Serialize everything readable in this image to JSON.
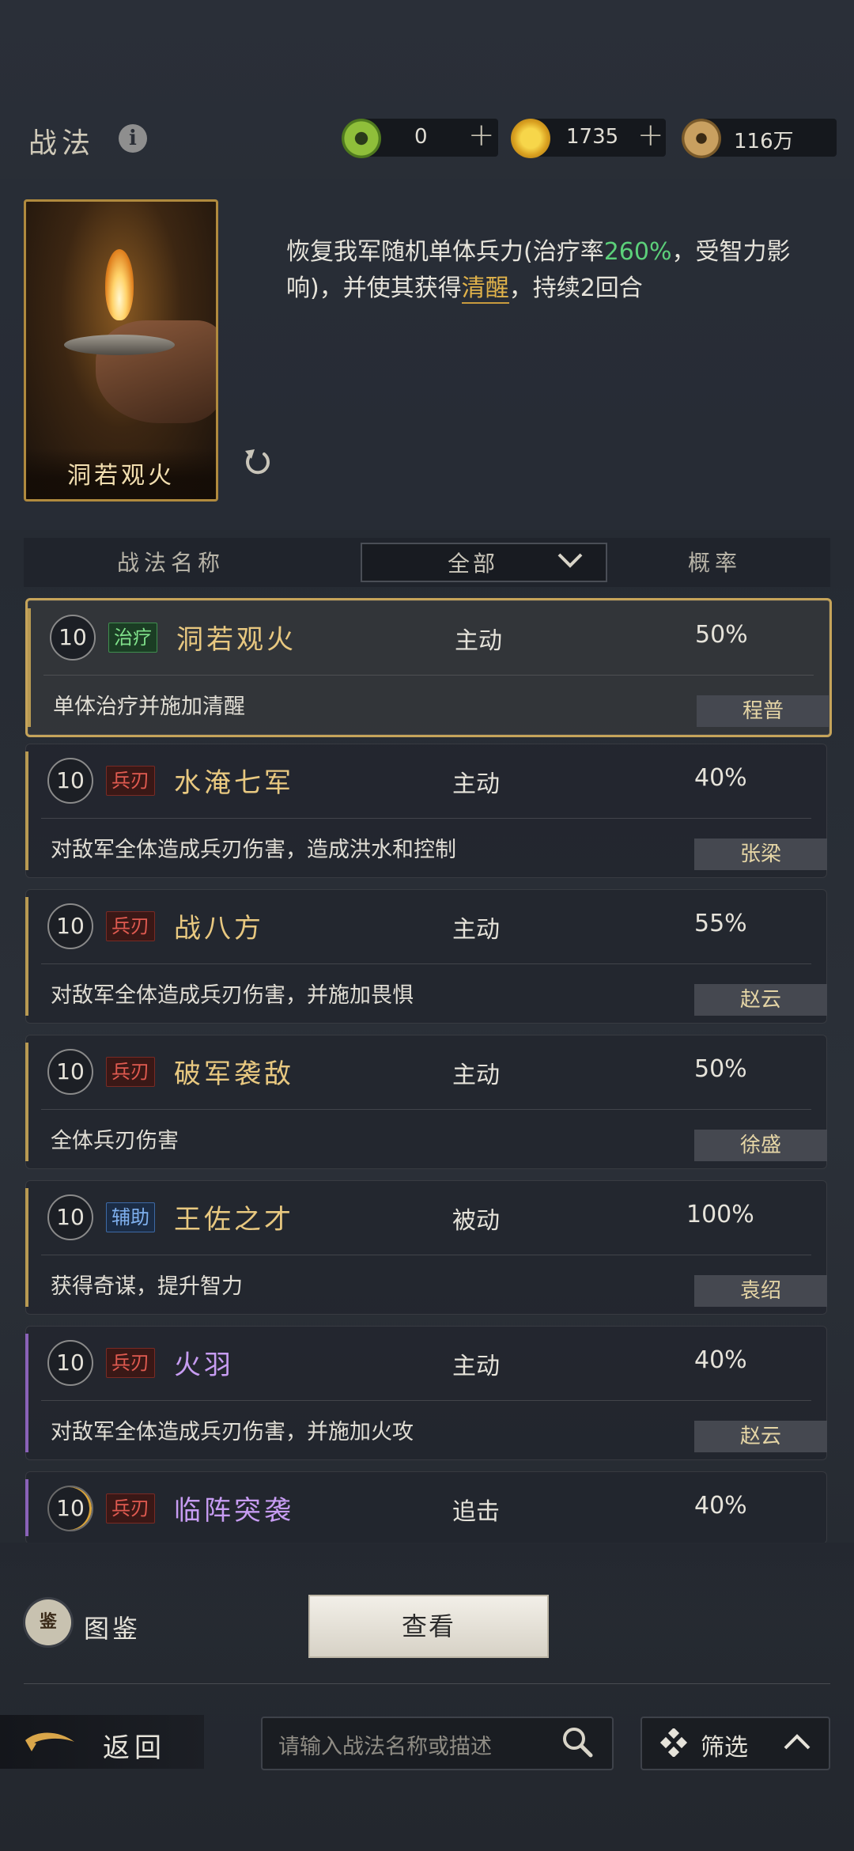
{
  "header": {
    "title": "战法",
    "resources": [
      {
        "icon": "jade-coin-icon",
        "value": "0"
      },
      {
        "icon": "gold-coin-icon",
        "value": "1735"
      },
      {
        "icon": "copper-coin-icon",
        "value": "116万"
      }
    ]
  },
  "detail": {
    "card_name": "洞若观火",
    "desc_part1": "恢复我军随机单体兵力(治疗率",
    "desc_rate": "260%",
    "desc_part2": "，受智力影响)，并使其获得",
    "desc_status": "清醒",
    "desc_part3": "，持续2回合"
  },
  "list_header": {
    "name": "战法名称",
    "filter": "全部",
    "rate": "概率"
  },
  "skills": [
    {
      "level": "10",
      "tag": "治疗",
      "name": "洞若观火",
      "type": "主动",
      "rate": "50%",
      "desc": "单体治疗并施加清醒",
      "owner": "程普"
    },
    {
      "level": "10",
      "tag": "兵刃",
      "name": "水淹七军",
      "type": "主动",
      "rate": "40%",
      "desc": "对敌军全体造成兵刃伤害，造成洪水和控制",
      "owner": "张梁"
    },
    {
      "level": "10",
      "tag": "兵刃",
      "name": "战八方",
      "type": "主动",
      "rate": "55%",
      "desc": "对敌军全体造成兵刃伤害，并施加畏惧",
      "owner": "赵云"
    },
    {
      "level": "10",
      "tag": "兵刃",
      "name": "破军袭敌",
      "type": "主动",
      "rate": "50%",
      "desc": "全体兵刃伤害",
      "owner": "徐盛"
    },
    {
      "level": "10",
      "tag": "辅助",
      "name": "王佐之才",
      "type": "被动",
      "rate": "100%",
      "desc": "获得奇谋，提升智力",
      "owner": "袁绍"
    },
    {
      "level": "10",
      "tag": "兵刃",
      "name": "火羽",
      "type": "主动",
      "rate": "40%",
      "desc": "对敌军全体造成兵刃伤害，并施加火攻",
      "owner": "赵云"
    },
    {
      "level": "10",
      "tag": "兵刃",
      "name": "临阵突袭",
      "type": "追击",
      "rate": "40%"
    }
  ],
  "footer": {
    "codex_label": "图鉴",
    "codex_icon_text": "鉴",
    "view_button": "查看",
    "back_label": "返回",
    "search_placeholder": "请输入战法名称或描述",
    "filter_label": "筛选"
  },
  "colors": {
    "gold_name": "#e8c880",
    "purple_name": "#c79cf2",
    "heal_tag": "#7fe08a",
    "blade_tag": "#e05a50",
    "aux_tag": "#7fb0ee",
    "highlight_green": "#5cd07a"
  }
}
